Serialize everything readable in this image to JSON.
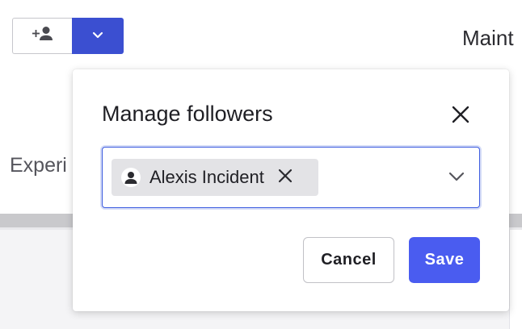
{
  "background": {
    "page_title_partial": "Maint",
    "section_label_partial": "Experi",
    "follow_button_icon": "person-add-icon",
    "follow_dropdown_icon": "chevron-down-icon"
  },
  "dialog": {
    "title": "Manage followers",
    "close_icon": "close-icon",
    "followers_field": {
      "chips": [
        {
          "label": "Alexis Incident",
          "icon": "person-icon",
          "remove_icon": "close-icon"
        }
      ],
      "chevron_icon": "chevron-down-icon"
    },
    "cancel_label": "Cancel",
    "save_label": "Save"
  },
  "colors": {
    "primary": "#4a5cf0",
    "primary_dark": "#3b4fd1",
    "focus_border": "#3d5ce0",
    "chip_bg": "#e3e3e6"
  }
}
